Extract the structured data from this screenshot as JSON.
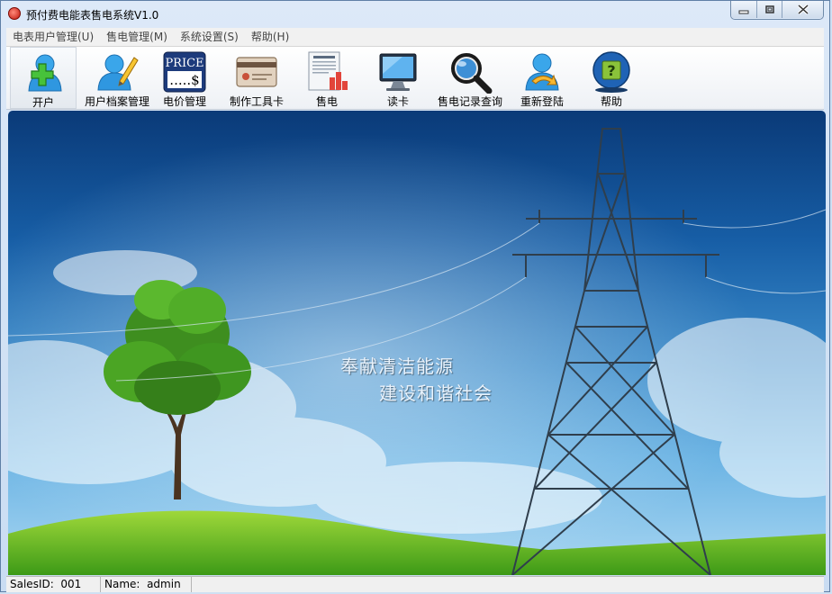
{
  "window": {
    "title": "预付费电能表售电系统V1.0"
  },
  "menu": [
    {
      "label": "电表用户管理(U)"
    },
    {
      "label": "售电管理(M)"
    },
    {
      "label": "系统设置(S)"
    },
    {
      "label": "帮助(H)"
    }
  ],
  "toolbar": [
    {
      "label": "开户",
      "icon": "add-user-icon"
    },
    {
      "label": "用户档案管理",
      "icon": "user-edit-icon"
    },
    {
      "label": "电价管理",
      "icon": "price-icon",
      "icon_text": "PRICE",
      "icon_subtext": ".....$"
    },
    {
      "label": "制作工具卡",
      "icon": "card-icon"
    },
    {
      "label": "售电",
      "icon": "invoice-icon"
    },
    {
      "label": "读卡",
      "icon": "monitor-icon"
    },
    {
      "label": "售电记录查询",
      "icon": "magnifier-icon"
    },
    {
      "label": "重新登陆",
      "icon": "relogin-icon"
    },
    {
      "label": "帮助",
      "icon": "help-icon",
      "icon_text": "?"
    }
  ],
  "banner": {
    "slogan_line1": "奉献清洁能源",
    "slogan_line2": "建设和谐社会"
  },
  "status": {
    "sales_id": "SalesID:  001",
    "name": "Name:  admin"
  }
}
